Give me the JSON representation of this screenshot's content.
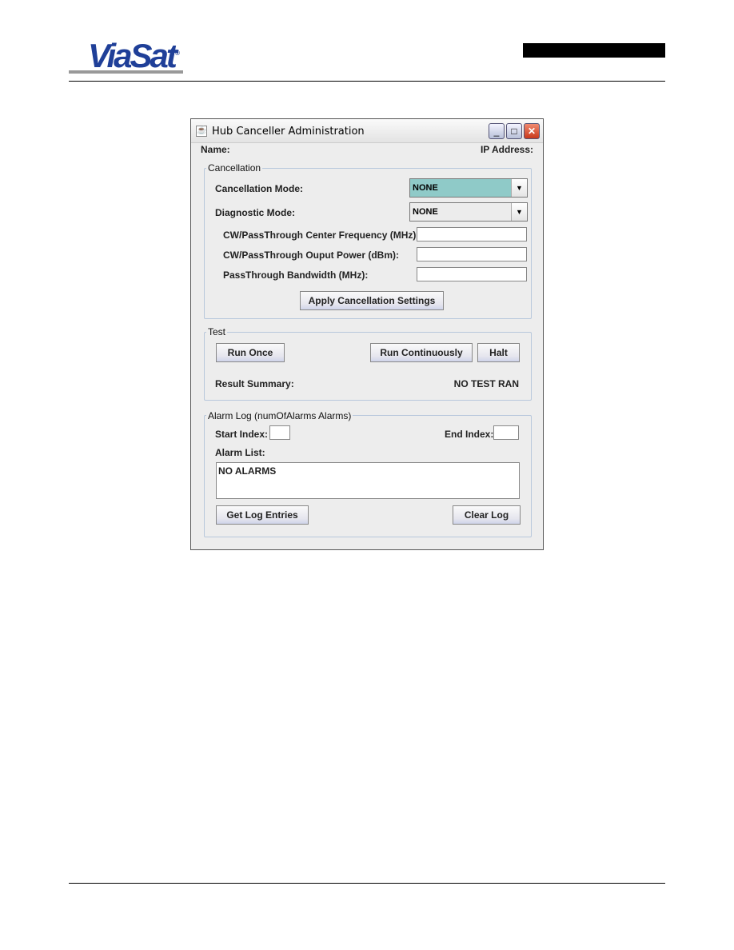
{
  "header": {
    "logo_text": "ViaSat",
    "logo_mark": "®"
  },
  "window": {
    "title": "Hub Canceller Administration",
    "icon": "java-cup-icon",
    "controls": {
      "minimize": "_",
      "maximize": "□",
      "close": "✕"
    },
    "name_label": "Name:",
    "ip_label": "IP Address:",
    "cancellation": {
      "legend": "Cancellation",
      "mode_label": "Cancellation Mode:",
      "mode_value": "NONE",
      "mode_color": "#8fcac8",
      "diag_label": "Diagnostic  Mode:",
      "diag_value": "NONE",
      "freq_label": "CW/PassThrough Center Frequency (MHz):",
      "freq_value": "",
      "power_label": "CW/PassThrough Ouput Power (dBm):",
      "power_value": "",
      "bw_label": "PassThrough Bandwidth (MHz):",
      "bw_value": "",
      "apply": "Apply Cancellation Settings"
    },
    "test": {
      "legend": "Test",
      "run_once": "Run Once",
      "run_cont": "Run Continuously",
      "halt": "Halt",
      "result_label": "Result Summary:",
      "result_value": "NO TEST RAN"
    },
    "alarm": {
      "legend": "Alarm Log (numOfAlarms Alarms)",
      "start_label": "Start Index:",
      "start_value": "",
      "end_label": "End Index:",
      "end_value": "",
      "list_label": "Alarm  List:",
      "list_value": "NO ALARMS",
      "get": "Get Log Entries",
      "clear": "Clear Log"
    }
  }
}
